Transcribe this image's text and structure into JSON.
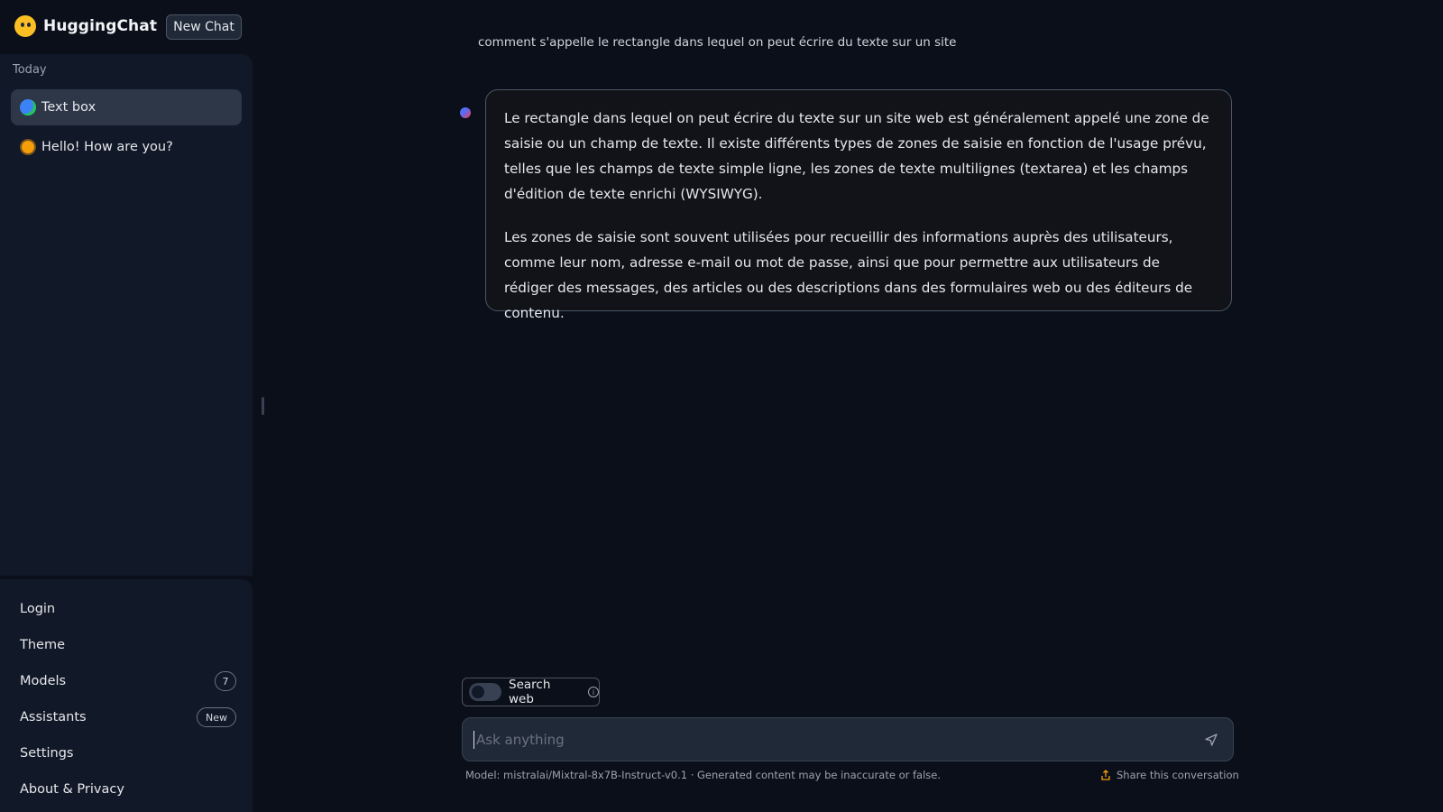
{
  "brand": {
    "name": "HuggingChat"
  },
  "header": {
    "new_chat_label": "New Chat"
  },
  "sidebar": {
    "section_label": "Today",
    "conversations": [
      {
        "label": "Text box",
        "icon": "globe-icon",
        "active": true
      },
      {
        "label": "Hello! How are you?",
        "icon": "sun-icon",
        "active": false
      }
    ],
    "menu": {
      "login": "Login",
      "theme": "Theme",
      "models": "Models",
      "models_count": "7",
      "assistants": "Assistants",
      "assistants_badge": "New",
      "settings": "Settings",
      "about": "About & Privacy"
    }
  },
  "chat": {
    "user_message": "comment s'appelle le rectangle dans lequel on peut écrire du texte sur un site",
    "assistant_paragraphs": [
      "Le rectangle dans lequel on peut écrire du texte sur un site web est généralement appelé une zone de saisie ou un champ de texte. Il existe différents types de zones de saisie en fonction de l'usage prévu, telles que les champs de texte simple ligne, les zones de texte multilignes (textarea) et les champs d'édition de texte enrichi (WYSIWYG).",
      "Les zones de saisie sont souvent utilisées pour recueillir des informations auprès des utilisateurs, comme leur nom, adresse e-mail ou mot de passe, ainsi que pour permettre aux utilisateurs de rédiger des messages, des articles ou des descriptions dans des formulaires web ou des éditeurs de contenu."
    ]
  },
  "composer": {
    "search_web_label": "Search web",
    "search_web_enabled": false,
    "input_value": "",
    "input_placeholder": "Ask anything",
    "model_info": "Model: mistralai/Mixtral-8x7B-Instruct-v0.1 · Generated content may be inaccurate or false.",
    "share_label": "Share this conversation"
  },
  "colors": {
    "background": "#0b0f1a",
    "sidebar": "#111827",
    "active_item": "#2d3748",
    "accent_logo": "#fbbf24"
  }
}
